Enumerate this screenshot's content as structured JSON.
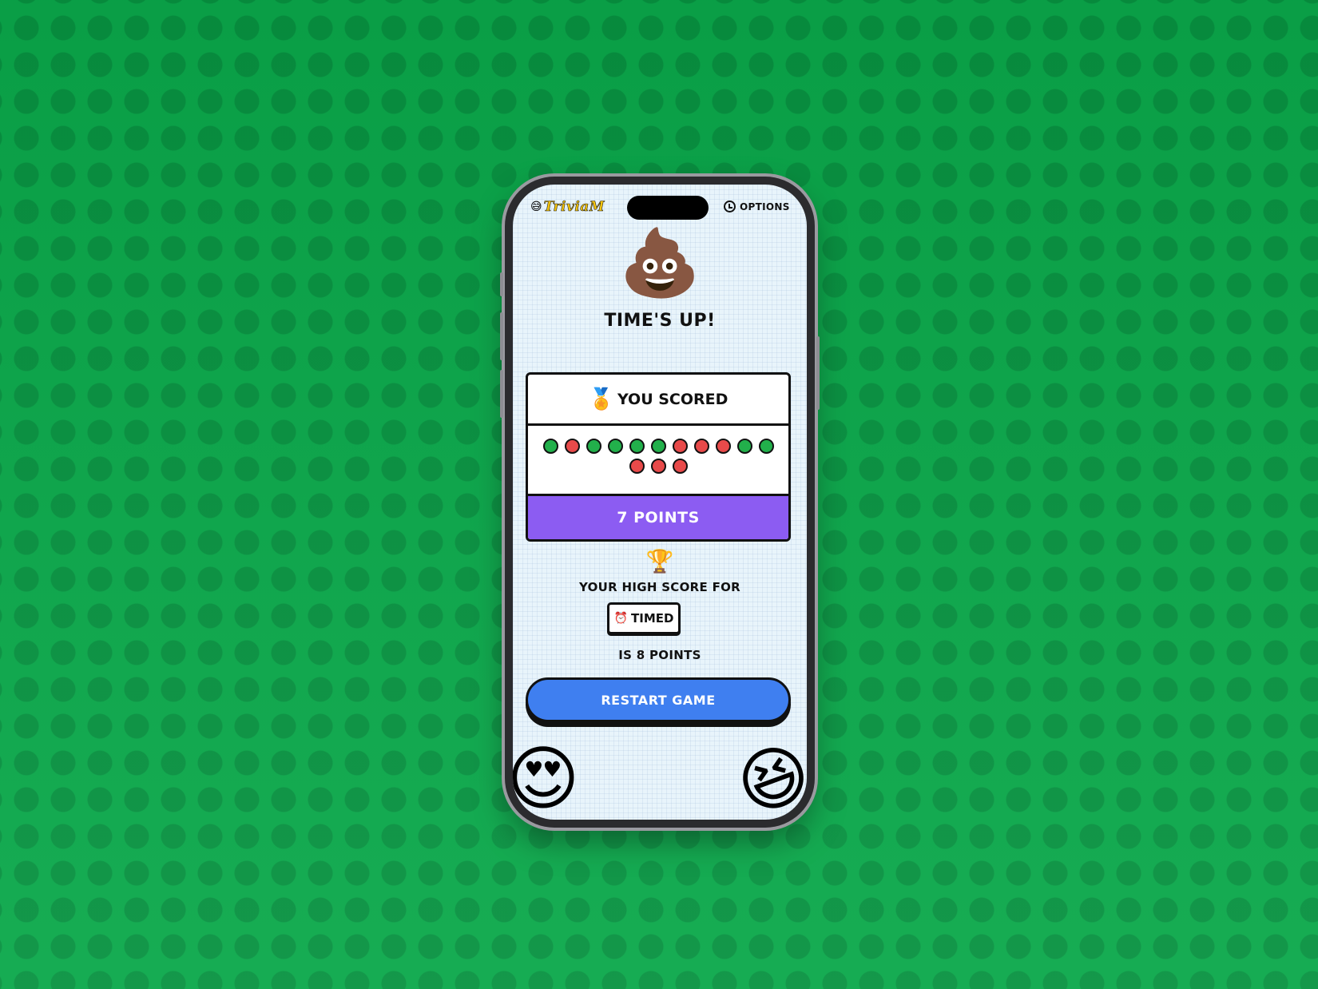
{
  "app": {
    "logo_text": "TriviaM",
    "logo_emoji": "😅",
    "options_label": "OPTIONS"
  },
  "result": {
    "emoji": "💩",
    "title": "TIME'S UP!",
    "scored_label": "YOU SCORED",
    "medal_emoji": "🏅",
    "answers": [
      "correct",
      "wrong",
      "correct",
      "correct",
      "correct",
      "correct",
      "wrong",
      "wrong",
      "wrong",
      "correct",
      "correct",
      "wrong",
      "wrong",
      "wrong"
    ],
    "points_label": "7 POINTS"
  },
  "high_score": {
    "trophy_emoji": "🏆",
    "label": "YOUR HIGH SCORE FOR",
    "mode_emoji": "⏰",
    "mode": "TIMED",
    "value_label": "IS 8 POINTS"
  },
  "restart_label": "RESTART GAME",
  "decor": {
    "left_emoji": "😍",
    "right_emoji": "😆"
  },
  "colors": {
    "correct": "#22b04b",
    "wrong": "#e84a4a",
    "points_bar": "#8c5cf2",
    "restart_button": "#3f7ff0",
    "background": "#0aa84a"
  }
}
